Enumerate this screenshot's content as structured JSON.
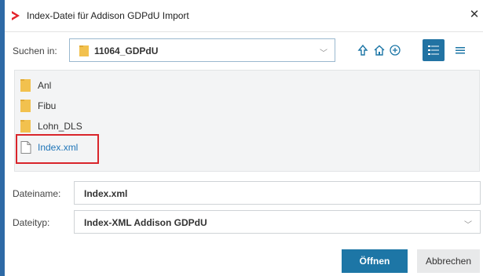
{
  "window": {
    "title": "Index-Datei für Addison GDPdU Import",
    "close_icon": "close-icon"
  },
  "toolbar": {
    "look_in_label": "Suchen in:",
    "look_in_value": "11064_GDPdU",
    "icons": [
      "up-arrow-icon",
      "home-icon",
      "new-folder-icon",
      "details-view-icon",
      "list-view-icon"
    ]
  },
  "files": [
    {
      "name": "Anl",
      "type": "folder"
    },
    {
      "name": "Fibu",
      "type": "folder"
    },
    {
      "name": "Lohn_DLS",
      "type": "folder"
    },
    {
      "name": "Index.xml",
      "type": "file",
      "selected": true
    }
  ],
  "filename": {
    "label": "Dateiname:",
    "value": "Index.xml"
  },
  "filetype": {
    "label": "Dateityp:",
    "value": "Index-XML Addison GDPdU"
  },
  "buttons": {
    "open": "Öffnen",
    "cancel": "Abbrechen"
  },
  "colors": {
    "accent": "#1d76a6",
    "selection_text": "#1f75b8",
    "highlight_box": "#d9252b",
    "folder": "#f2c14e",
    "window_frame": "#2e6aa6"
  }
}
